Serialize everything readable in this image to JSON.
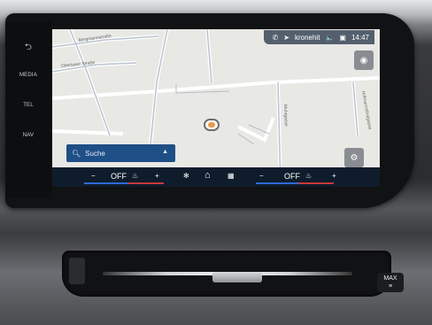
{
  "hardkeys": {
    "back_icon": "return-arrow-icon",
    "media": "MEDIA",
    "tel": "TEL",
    "nav": "NAV"
  },
  "status": {
    "station": "kronehit",
    "time": "14:47"
  },
  "map": {
    "streets": [
      "Bergmannstraße",
      "Oberlaaer Straße",
      "Hofmannsthalgasse",
      "Muhrgasse"
    ]
  },
  "search": {
    "label": "Suche"
  },
  "climate": {
    "left_minus": "−",
    "left_value": "OFF",
    "left_plus": "+",
    "right_minus": "−",
    "right_value": "OFF",
    "right_plus": "+"
  },
  "vent": {
    "max_label": "MAX"
  }
}
